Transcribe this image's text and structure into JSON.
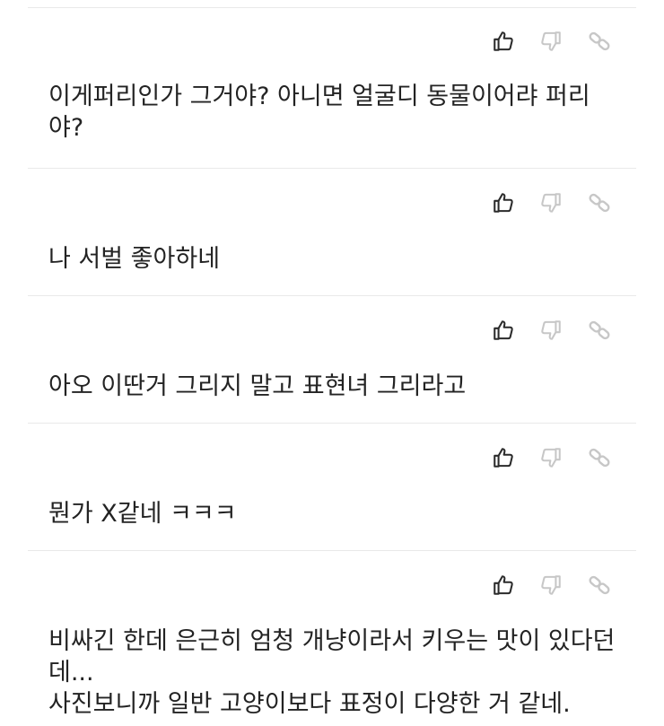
{
  "comments": [
    {
      "text": "이게퍼리인가 그거야? 아니면 얼굴디 동물이어랴 퍼리야?"
    },
    {
      "text": "나 서벌 좋아하네"
    },
    {
      "text": "아오 이딴거 그리지 말고 표현녀 그리라고"
    },
    {
      "text": "뭔가 X같네 ㅋㅋㅋ"
    },
    {
      "text": "비싸긴 한데 은근히 엄청 개냥이라서 키우는 맛이 있다던데...\n사진보니까 일반 고양이보다 표정이 다양한 거 같네."
    }
  ],
  "icons": {
    "like": "thumbs-up-icon",
    "dislike": "thumbs-down-icon",
    "link": "link-icon"
  },
  "colors": {
    "like": "#2b2b2b",
    "inactive": "#c7c7c7",
    "divider": "#e9e9e9",
    "text": "#232323"
  }
}
